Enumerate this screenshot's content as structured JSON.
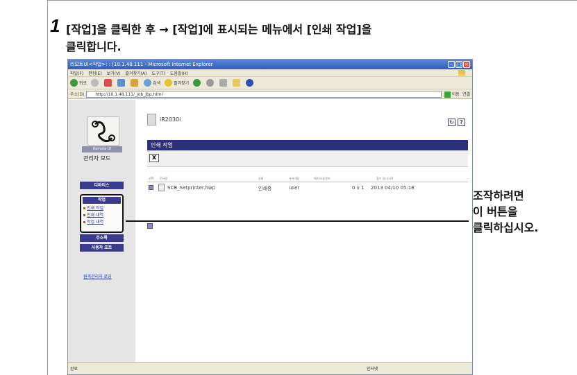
{
  "step": {
    "number": "1",
    "instruction_line1": "[작업]을 클릭한 후 → [작업]에 표시되는 메뉴에서 [인쇄 작업]을",
    "instruction_line2": "클릭합니다."
  },
  "browser": {
    "title": "리모트UI<작업>: : [10.1.48.111 - Microsoft Internet Explorer",
    "menu": [
      "파일(F)",
      "편집(E)",
      "보기(V)",
      "즐겨찾기(A)",
      "도구(T)",
      "도움말(H)"
    ],
    "toolbar": {
      "back": "뒤로",
      "search": "검색",
      "favorites": "즐겨찾기"
    },
    "address_label": "주소(D)",
    "url": "http://10.1.48.111/_Job_Jbp.html",
    "go_label": "이동",
    "links_label": "연결",
    "status_left": "완료",
    "status_right": "인터넷"
  },
  "sidebar": {
    "logo_caption": "Remote UI",
    "manager_mode": "관리자 모드",
    "device_label": "디바이스",
    "job_header": "작업",
    "job_links": [
      "인쇄 작업",
      "인쇄 내역",
      "작업 내역"
    ],
    "addressbook_label": "주소록",
    "user_portal_label": "사용자 포트",
    "remote_link": "원격관리자 로딩"
  },
  "main": {
    "device_name": "iR2030i",
    "panel_title": "인쇄 작업",
    "delete_label": "X",
    "columns": [
      "선택",
      "문서명",
      "상태",
      "유저이름",
      "매수/오류정보",
      "접수 일시/시작"
    ],
    "job": {
      "filename": "SCB_Setprinter.hwp",
      "status": "인쇄중",
      "user": "user",
      "copies": "0 x 1",
      "time": "2013 04/10 05:18"
    }
  },
  "callout": {
    "line1": "조작하려면",
    "line2": "이 버튼을",
    "line3": "클릭하십시오."
  }
}
